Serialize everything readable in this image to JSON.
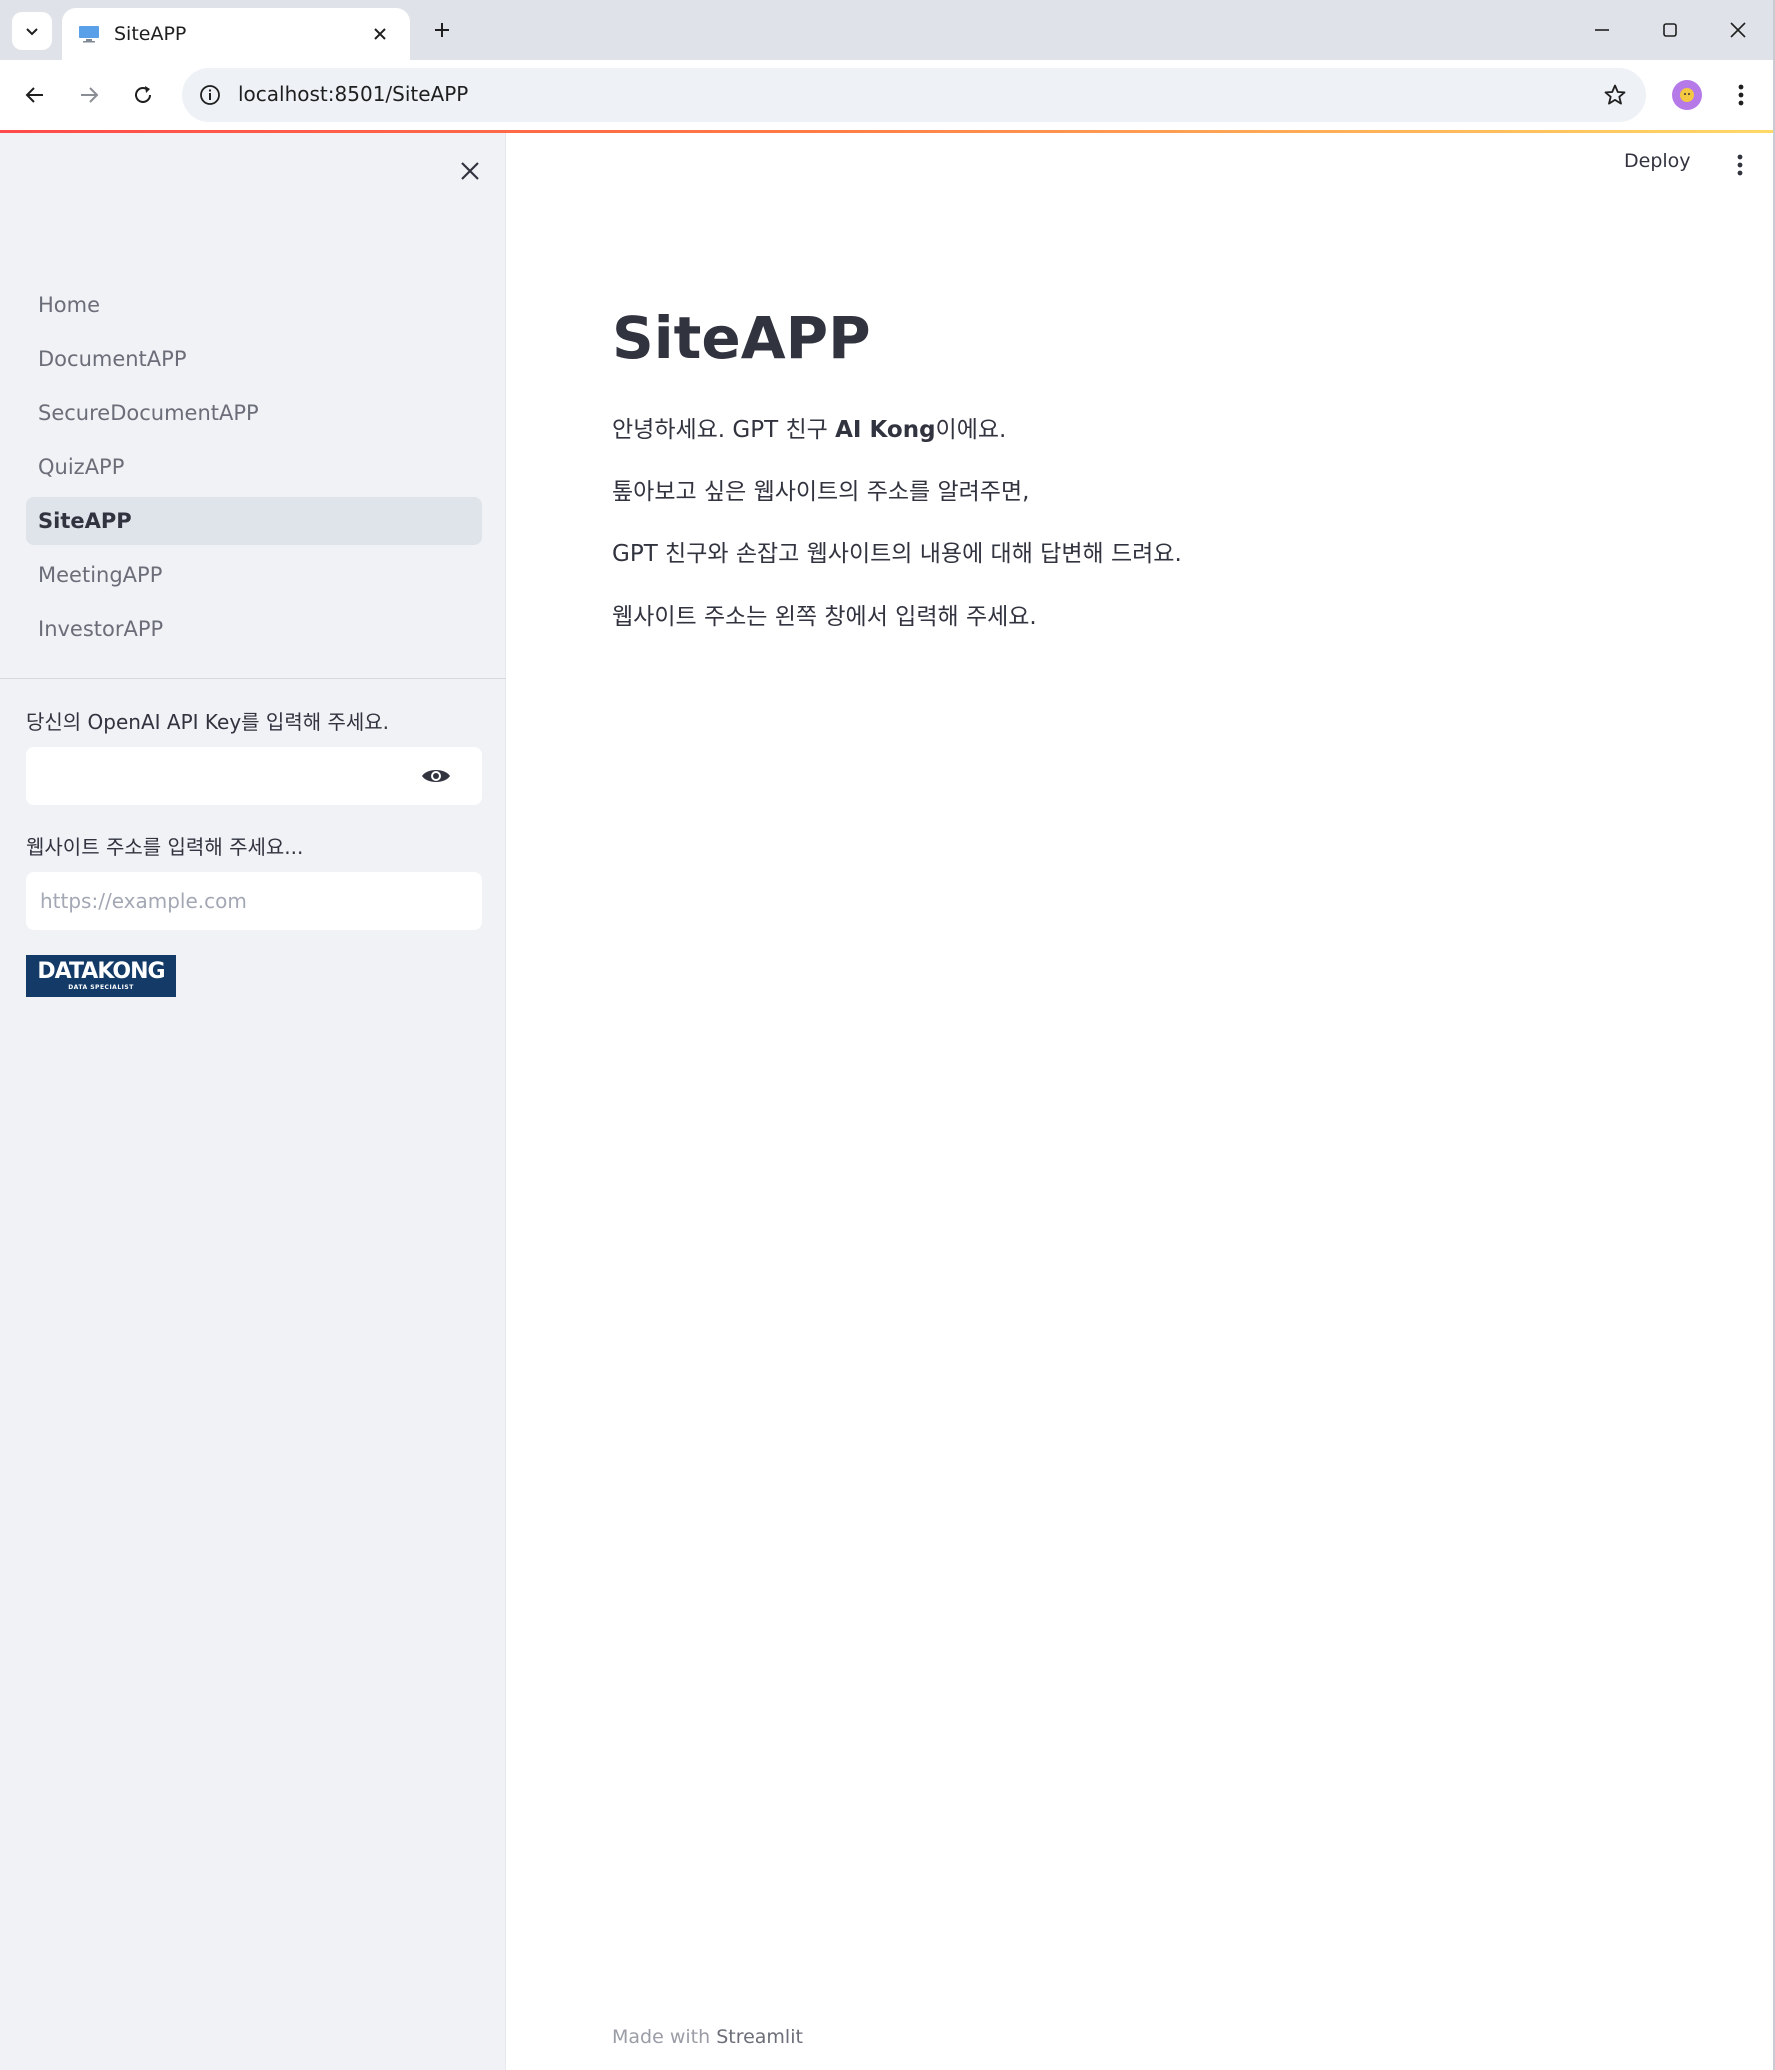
{
  "browser": {
    "tab_title": "SiteAPP",
    "url": "localhost:8501/SiteAPP"
  },
  "sidebar": {
    "nav_items": [
      {
        "label": "Home",
        "active": false
      },
      {
        "label": "DocumentAPP",
        "active": false
      },
      {
        "label": "SecureDocumentAPP",
        "active": false
      },
      {
        "label": "QuizAPP",
        "active": false
      },
      {
        "label": "SiteAPP",
        "active": true
      },
      {
        "label": "MeetingAPP",
        "active": false
      },
      {
        "label": "InvestorAPP",
        "active": false
      }
    ],
    "api_key_label": "당신의 OpenAI API Key를 입력해 주세요.",
    "api_key_value": "",
    "url_label": "웹사이트 주소를 입력해 주세요...",
    "url_placeholder": "https://example.com",
    "logo_text": "DATAKONG",
    "logo_subtext": "DATA SPECIALIST"
  },
  "header": {
    "deploy_label": "Deploy"
  },
  "main": {
    "title": "SiteAPP",
    "line1_prefix": "안녕하세요. GPT 친구 ",
    "line1_bold": "AI Kong",
    "line1_suffix": "이에요.",
    "line2": "톺아보고 싶은 웹사이트의 주소를 알려주면,",
    "line3": "GPT 친구와 손잡고 웹사이트의 내용에 대해 답변해 드려요.",
    "line4": "웹사이트 주소는 왼쪽 창에서 입력해 주세요."
  },
  "footer": {
    "prefix": "Made with ",
    "brand": "Streamlit"
  },
  "colors": {
    "accent": "#ff4b4b",
    "sidebar_bg": "#f0f2f6",
    "text": "#31333f"
  }
}
